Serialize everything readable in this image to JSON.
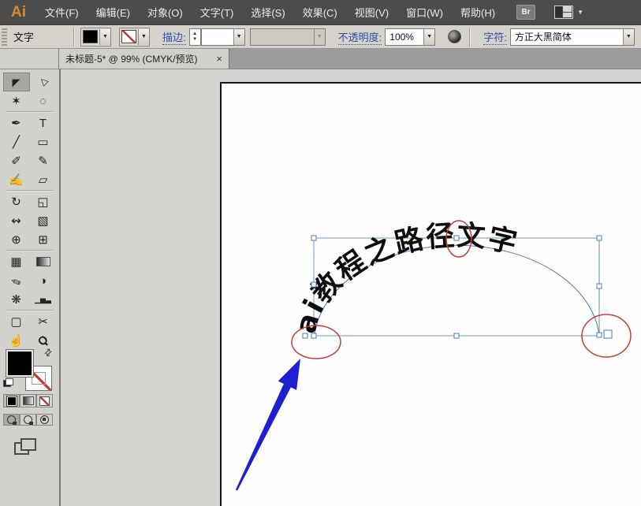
{
  "app": {
    "logo": "Ai",
    "bridge_button": "Br"
  },
  "menu": {
    "items": [
      {
        "id": "file",
        "label": "文件(F)"
      },
      {
        "id": "edit",
        "label": "编辑(E)"
      },
      {
        "id": "object",
        "label": "对象(O)"
      },
      {
        "id": "type",
        "label": "文字(T)"
      },
      {
        "id": "select",
        "label": "选择(S)"
      },
      {
        "id": "effect",
        "label": "效果(C)"
      },
      {
        "id": "view",
        "label": "视图(V)"
      },
      {
        "id": "window",
        "label": "窗口(W)"
      },
      {
        "id": "help",
        "label": "帮助(H)"
      }
    ]
  },
  "control_bar": {
    "context_label": "文字",
    "stroke_label": "描边:",
    "stroke_width_value": "",
    "profile_value": "",
    "opacity_label": "不透明度:",
    "opacity_value": "100%",
    "character_label": "字符:",
    "font_name": "方正大黑简体"
  },
  "tab": {
    "title": "未标题-5* @ 99% (CMYK/预览)",
    "close_icon": "×"
  },
  "toolbar": {
    "tools": [
      {
        "id": "selection",
        "glyph": "◤",
        "active": true
      },
      {
        "id": "direct-selection",
        "glyph": "▷"
      },
      {
        "id": "magic-wand",
        "glyph": "✶"
      },
      {
        "id": "lasso",
        "glyph": "◌"
      },
      {
        "id": "pen",
        "glyph": "✒"
      },
      {
        "id": "type",
        "glyph": "T"
      },
      {
        "id": "line-segment",
        "glyph": "╱"
      },
      {
        "id": "rectangle",
        "glyph": "▭"
      },
      {
        "id": "paintbrush",
        "glyph": "✐"
      },
      {
        "id": "pencil",
        "glyph": "✎"
      },
      {
        "id": "blob-brush",
        "glyph": "✍"
      },
      {
        "id": "eraser",
        "glyph": "▱"
      },
      {
        "id": "rotate",
        "glyph": "↻"
      },
      {
        "id": "scale",
        "glyph": "◱"
      },
      {
        "id": "width-tool",
        "glyph": "↭"
      },
      {
        "id": "free-transform",
        "glyph": "▧"
      },
      {
        "id": "shape-builder",
        "glyph": "⊕"
      },
      {
        "id": "perspective-grid",
        "glyph": "⊞"
      },
      {
        "id": "mesh",
        "glyph": "▦"
      },
      {
        "id": "gradient",
        "glyph": ""
      },
      {
        "id": "eyedropper",
        "glyph": "✏"
      },
      {
        "id": "blend",
        "glyph": "◑"
      },
      {
        "id": "symbol-sprayer",
        "glyph": "❋"
      },
      {
        "id": "column-graph",
        "glyph": "▁▅▃"
      },
      {
        "id": "artboard",
        "glyph": "▢"
      },
      {
        "id": "slice",
        "glyph": "✂"
      },
      {
        "id": "hand",
        "glyph": "☝"
      },
      {
        "id": "zoom",
        "glyph": "Ϙ"
      }
    ]
  },
  "canvas": {
    "path_text": "ai教程之路径文字"
  },
  "icons": {
    "dropdown": "▼",
    "spinner_up": "▲",
    "spinner_down": "▼",
    "swap": "⇄",
    "workspace_caret": "▼"
  },
  "colors": {
    "menubar_bg": "#4c4c4c",
    "logo_orange": "#e0872f",
    "panel_gray": "#d5d2cb",
    "link_blue": "#2a50a8",
    "selection_blue": "#5b82bb",
    "annotation_red": "#bf4135",
    "arrow_blue": "#1e1ed2",
    "fill_black": "#000000"
  }
}
